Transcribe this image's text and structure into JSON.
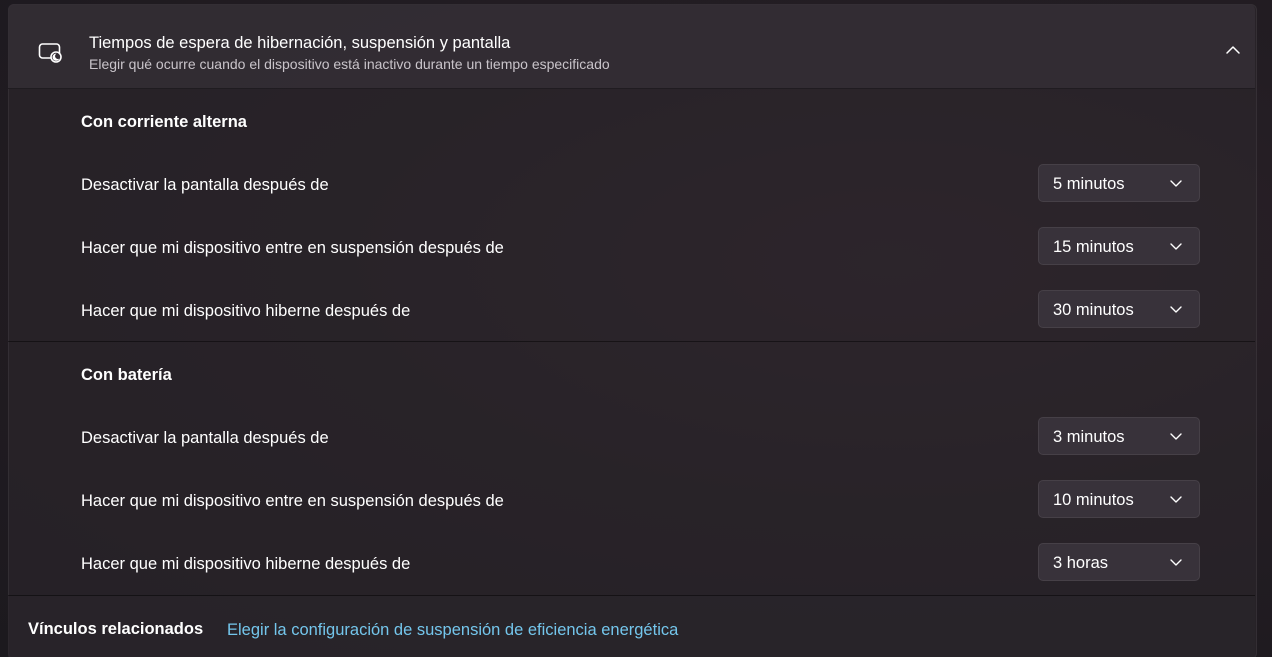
{
  "header": {
    "icon": "screen-sleep-icon",
    "title": "Tiempos de espera de hibernación, suspensión y pantalla",
    "subtitle": "Elegir qué ocurre cuando el dispositivo está inactivo durante un tiempo especificado",
    "chevron": "chevron-up-icon"
  },
  "ac": {
    "title": "Con corriente alterna",
    "rows": [
      {
        "label": "Desactivar la pantalla después de",
        "value": "5 minutos"
      },
      {
        "label": "Hacer que mi dispositivo entre en suspensión después de",
        "value": "15 minutos"
      },
      {
        "label": "Hacer que mi dispositivo hiberne después de",
        "value": "30 minutos"
      }
    ]
  },
  "battery": {
    "title": "Con batería",
    "rows": [
      {
        "label": "Desactivar la pantalla después de",
        "value": "3 minutos"
      },
      {
        "label": "Hacer que mi dispositivo entre en suspensión después de",
        "value": "10 minutos"
      },
      {
        "label": "Hacer que mi dispositivo hiberne después de",
        "value": "3 horas"
      }
    ]
  },
  "related": {
    "label": "Vínculos relacionados",
    "link": "Elegir la configuración de suspensión de eficiencia energética"
  },
  "colors": {
    "link": "#74c6ec",
    "background": "#1f1b21",
    "dropdown": "#38323a"
  }
}
